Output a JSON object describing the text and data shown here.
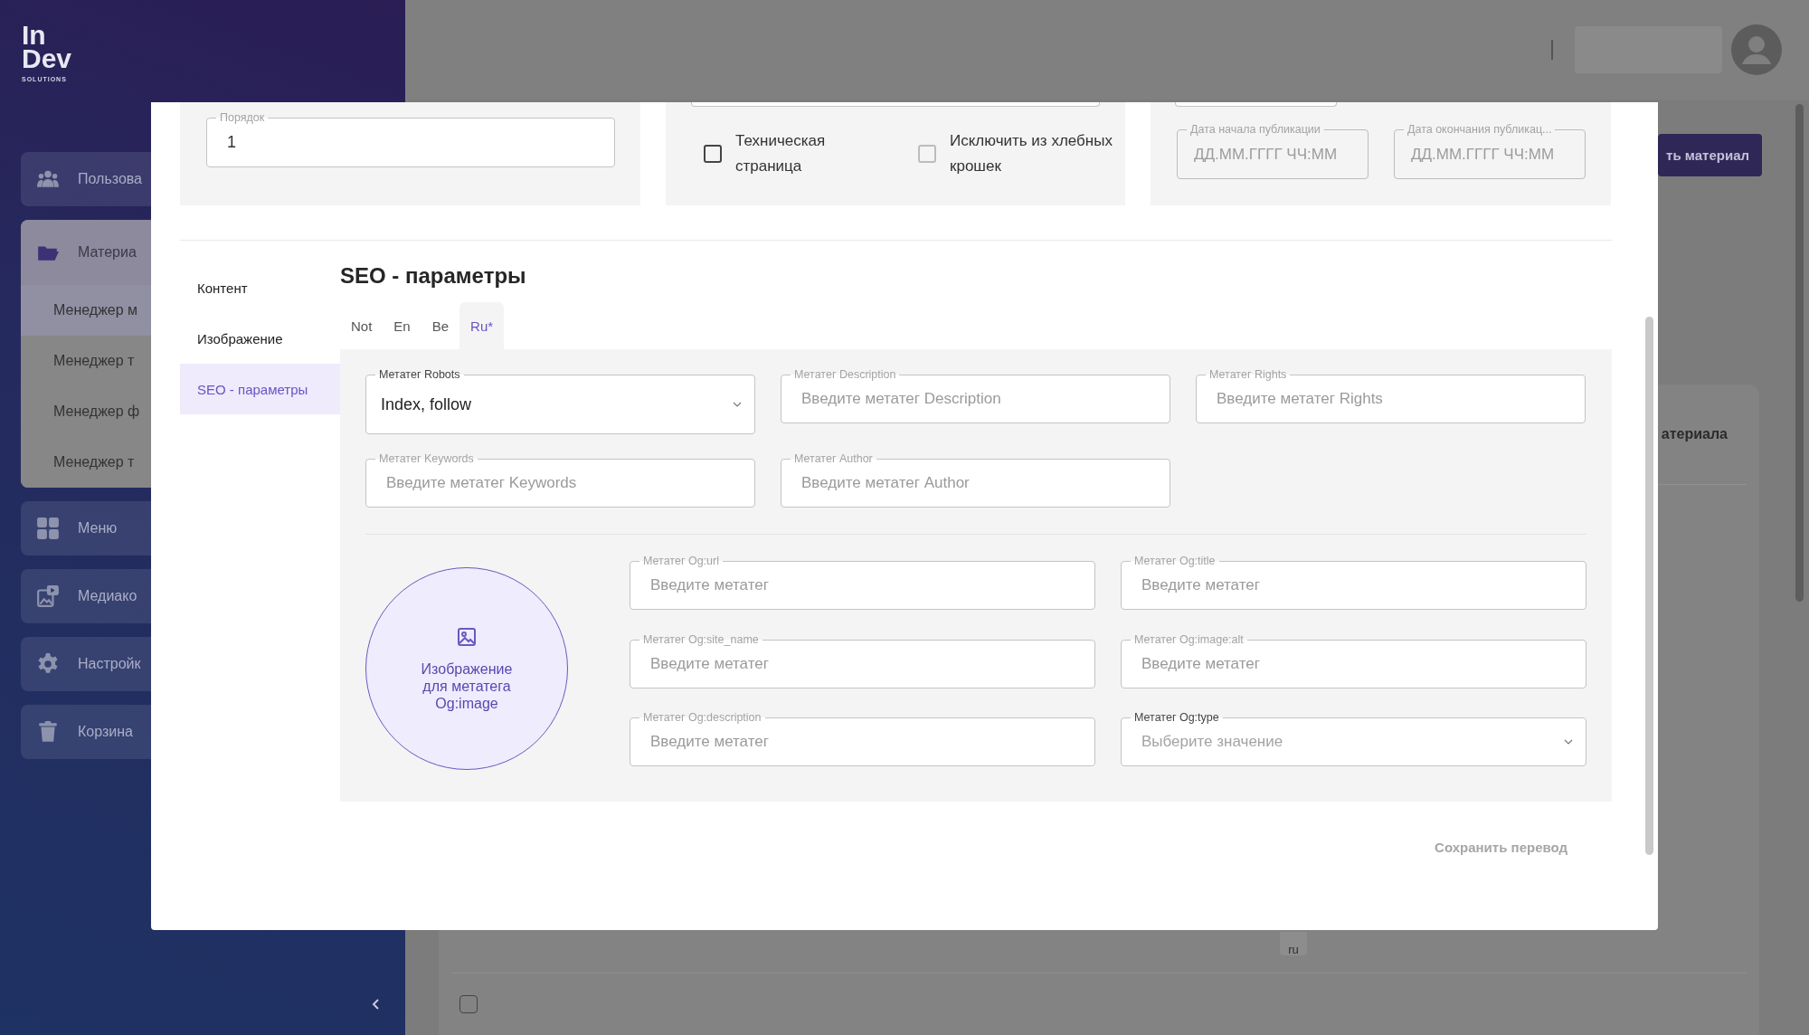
{
  "sidebar": {
    "logo": {
      "top": "In",
      "bottom": "Dev",
      "tagline": "SOLUTIONS"
    },
    "items": [
      {
        "label": "Пользова",
        "selected": false
      },
      {
        "label": "Материа",
        "selected": true,
        "expanded": true,
        "children": [
          {
            "label": "Менеджер м",
            "selected": true
          },
          {
            "label": "Менеджер т",
            "selected": false
          },
          {
            "label": "Менеджер ф",
            "selected": false
          },
          {
            "label": "Менеджер т",
            "selected": false
          }
        ]
      },
      {
        "label": "Меню",
        "selected": false
      },
      {
        "label": "Медиако",
        "selected": false
      },
      {
        "label": "Настройк",
        "selected": false
      },
      {
        "label": "Корзина",
        "selected": false
      }
    ]
  },
  "page": {
    "add_button": "ть материал",
    "table_title": "атериала",
    "lang_chip": "ru",
    "row_checkbox": {
      "checked": false
    }
  },
  "modal": {
    "order_field": {
      "label": "Порядок",
      "value": "1"
    },
    "checkboxes": [
      {
        "label": "Техническая страница",
        "checked": false,
        "disabled": false
      },
      {
        "label": "Исключить из хлебных крошек",
        "checked": false,
        "disabled": true
      }
    ],
    "date_fields": [
      {
        "label": "Дата начала публикации",
        "placeholder": "ДД.ММ.ГГГГ ЧЧ:ММ"
      },
      {
        "label": "Дата окончания публикац...",
        "placeholder": "ДД.ММ.ГГГГ ЧЧ:ММ"
      }
    ],
    "nav": [
      {
        "label": "Контент",
        "selected": false
      },
      {
        "label": "Изображение",
        "selected": false
      },
      {
        "label": "SEO - параметры",
        "selected": true
      }
    ],
    "heading": "SEO - параметры",
    "tabs": [
      {
        "label": "Not",
        "selected": false
      },
      {
        "label": "En",
        "selected": false
      },
      {
        "label": "Be",
        "selected": false
      },
      {
        "label": "Ru*",
        "selected": true
      }
    ],
    "meta_fields": [
      {
        "kind": "select",
        "label": "Метатег Robots",
        "value": "Index, follow"
      },
      {
        "kind": "input",
        "label": "Метатег Description",
        "placeholder": "Введите метатег Description"
      },
      {
        "kind": "input",
        "label": "Метатег Rights",
        "placeholder": "Введите метатег Rights"
      },
      {
        "kind": "input",
        "label": "Метатег Keywords",
        "placeholder": "Введите метатег Keywords"
      },
      {
        "kind": "input",
        "label": "Метатег Author",
        "placeholder": "Введите метатег Author"
      }
    ],
    "og_image": {
      "label": "Изображение для метатега Og:image"
    },
    "og_fields": [
      {
        "kind": "input",
        "label": "Метатег Og:url",
        "placeholder": "Введите метатег"
      },
      {
        "kind": "input",
        "label": "Метатег Og:title",
        "placeholder": "Введите метатег"
      },
      {
        "kind": "input",
        "label": "Метатег Og:site_name",
        "placeholder": "Введите метатег"
      },
      {
        "kind": "input",
        "label": "Метатег Og:image:alt",
        "placeholder": "Введите метатег"
      },
      {
        "kind": "input",
        "label": "Метатег Og:description",
        "placeholder": "Введите метатег"
      },
      {
        "kind": "select",
        "label": "Метатег Og:type",
        "placeholder": "Выберите значение"
      }
    ],
    "save_button": {
      "label": "Сохранить перевод",
      "disabled": true
    }
  }
}
